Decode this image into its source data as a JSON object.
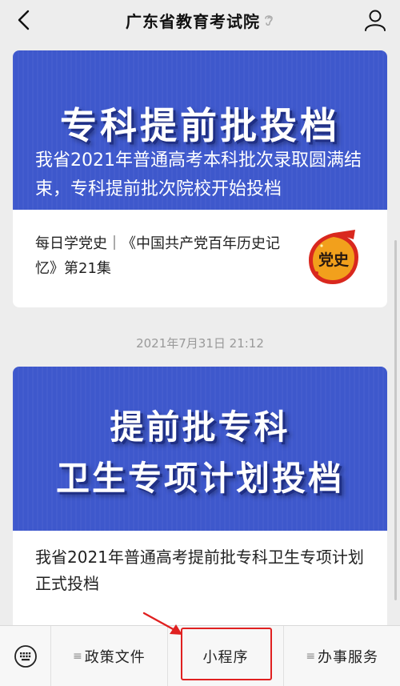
{
  "header": {
    "title": "广东省教育考试院"
  },
  "articles": [
    {
      "banner_title": "专科提前批投档",
      "banner_subtitle": "我省2021年普通高考本科批次录取圆满结束，专科提前批次院校开始投档",
      "description": "每日学党史｜《中国共产党百年历史记忆》第21集",
      "badge_text": "党史"
    },
    {
      "banner_line1": "提前批专科",
      "banner_line2": "卫生专项计划投档",
      "description": "我省2021年普通高考提前批专科卫生专项计划正式投档"
    }
  ],
  "timestamp": "2021年7月31日 21:12",
  "bottom_menu": [
    {
      "label": "政策文件",
      "has_submenu": true
    },
    {
      "label": "小程序",
      "has_submenu": false
    },
    {
      "label": "办事服务",
      "has_submenu": true
    }
  ],
  "colors": {
    "banner_blue": "#3e58cc",
    "highlight_red": "#e02020",
    "badge_orange": "#f2a01c"
  }
}
